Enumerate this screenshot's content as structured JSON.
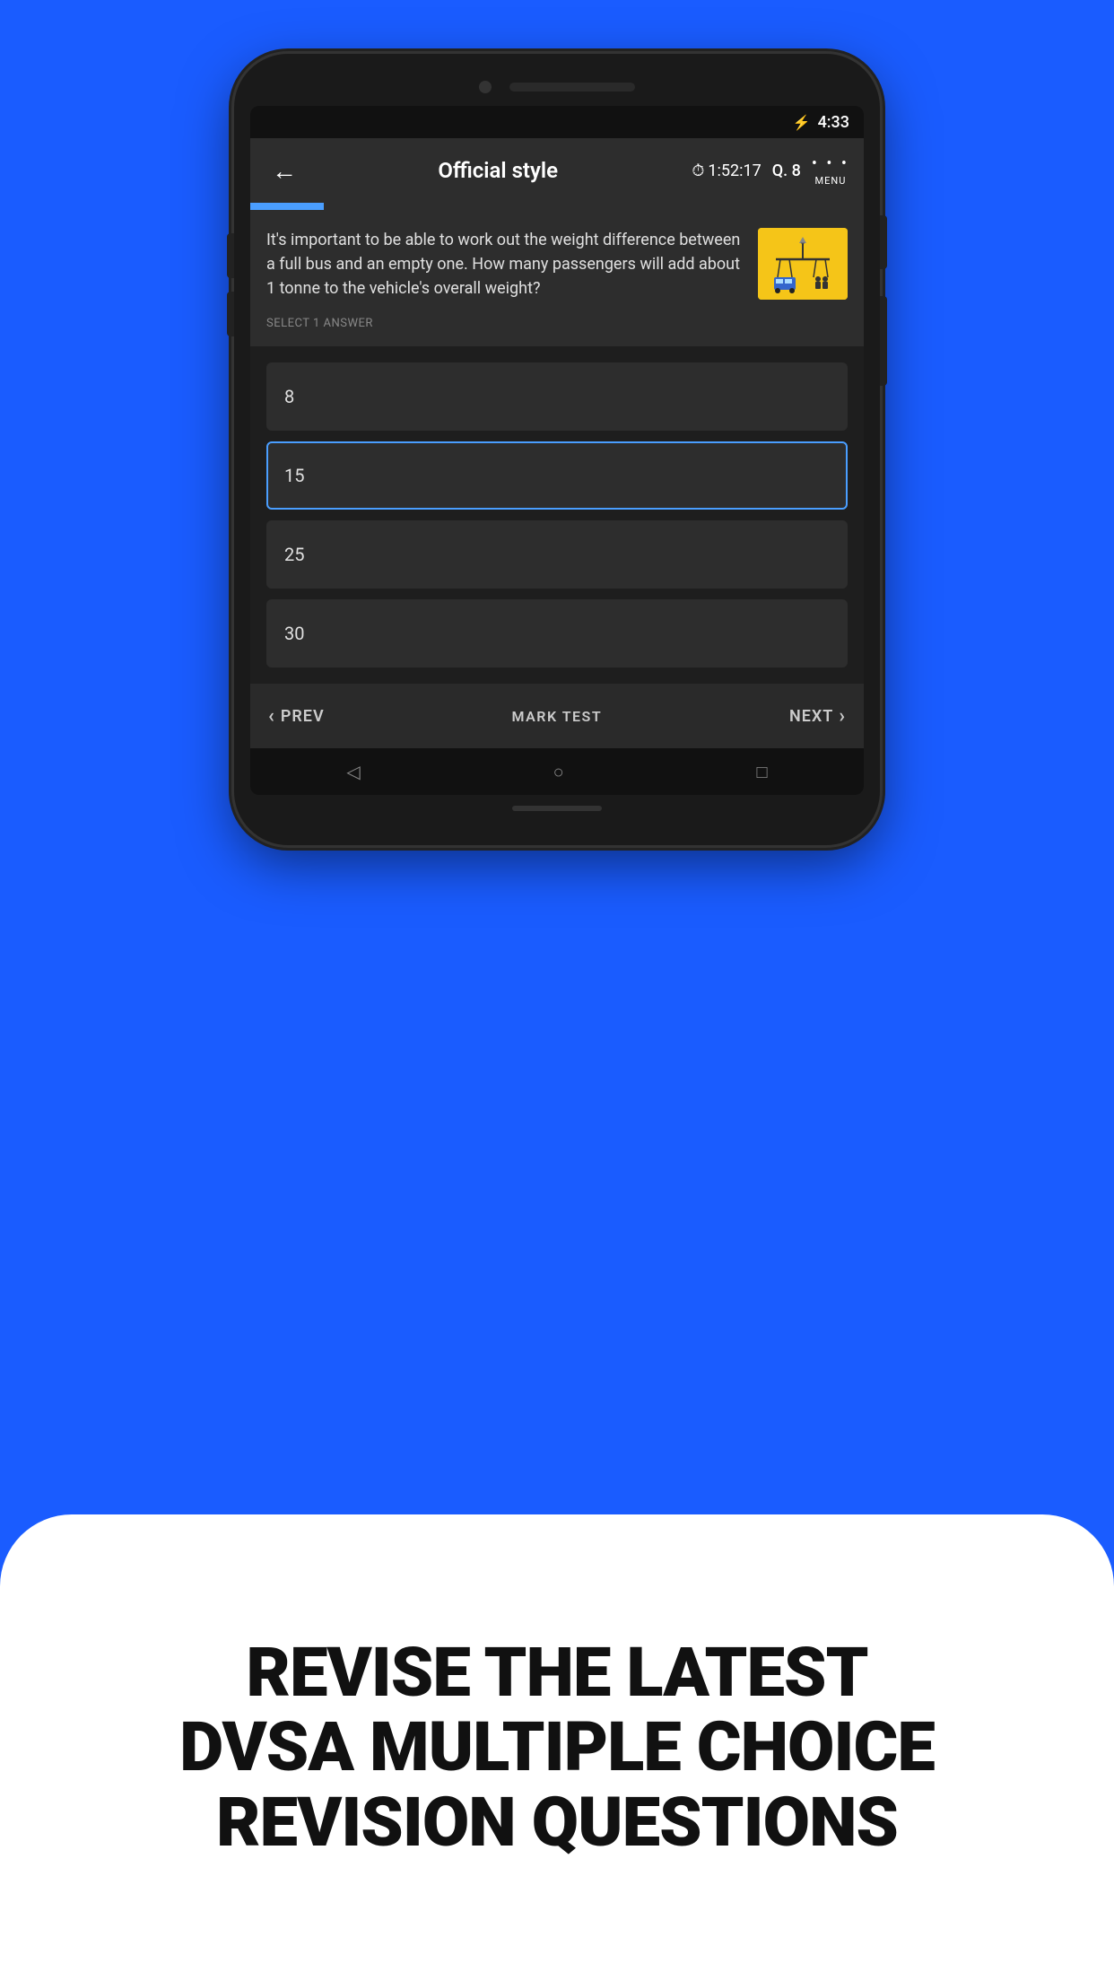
{
  "status_bar": {
    "time": "4:33",
    "battery_icon": "🔋"
  },
  "toolbar": {
    "back_label": "←",
    "title": "Official style",
    "timer_icon": "⏱",
    "timer_value": "1:52:17",
    "question_label": "Q. 8",
    "menu_dots": "• • •",
    "menu_label": "MENU"
  },
  "question": {
    "text": "It's important to be able to work out the weight difference between a full bus and an empty one. How many passengers will add about 1 tonne to the vehicle's overall weight?",
    "select_label": "SELECT 1 ANSWER"
  },
  "answers": [
    {
      "id": "a",
      "value": "8",
      "selected": false
    },
    {
      "id": "b",
      "value": "15",
      "selected": true
    },
    {
      "id": "c",
      "value": "25",
      "selected": false
    },
    {
      "id": "d",
      "value": "30",
      "selected": false
    }
  ],
  "bottom_nav": {
    "prev_label": "PREV",
    "mark_label": "MARK TEST",
    "next_label": "NEXT"
  },
  "promo": {
    "line1": "REVISE THE LATEST",
    "line2": "DVSA MULTIPLE CHOICE",
    "line3": "REVISION QUESTIONS"
  }
}
